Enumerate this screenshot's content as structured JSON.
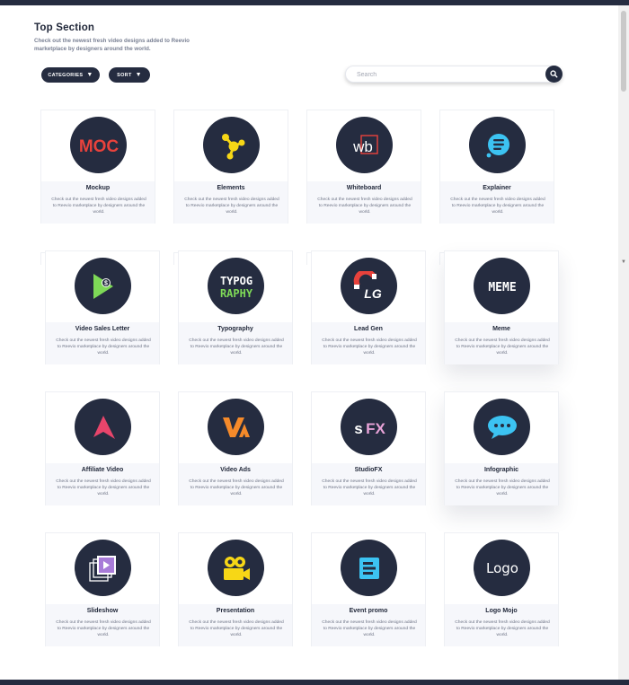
{
  "header": {
    "title": "Top Section",
    "subtitle": "Check out the newest fresh video designs added to Reevio marketplace by designers around the world."
  },
  "controls": {
    "categories_label": "CATEGORIES",
    "sort_label": "SORT",
    "search_placeholder": "Search"
  },
  "colors": {
    "navy": "#252c40",
    "accent_yellow": "#f7d716",
    "accent_red": "#e8423c",
    "accent_blue": "#3cc3f2",
    "accent_pink": "#e8456b",
    "accent_orange": "#f58a2a",
    "accent_green": "#7ed957"
  },
  "cards": [
    {
      "name": "Mockup",
      "description": "Check out the newest fresh video designs added to Reevio marketplace by designers around the world.",
      "icon": "mockup-logo-icon"
    },
    {
      "name": "Elements",
      "description": "Check out the newest fresh video designs added to Reevio marketplace by designers around the world.",
      "icon": "elements-network-icon"
    },
    {
      "name": "Whiteboard",
      "description": "Check out the newest fresh video designs added to Reevio marketplace by designers around the world.",
      "icon": "whiteboard-wb-icon"
    },
    {
      "name": "Explainer",
      "description": "Check out the newest fresh video designs added to Reevio marketplace by designers around the world.",
      "icon": "explainer-bubble-icon"
    },
    {
      "name": "Video Sales Letter",
      "description": "Check out the newest fresh video designs added to Reevio marketplace by designers around the world.",
      "icon": "play-dollar-icon"
    },
    {
      "name": "Typography",
      "description": "Check out the newest fresh video designs added to Reevio marketplace by designers around the world.",
      "icon": "typography-text-icon"
    },
    {
      "name": "Lead Gen",
      "description": "Check out the newest fresh video designs added to Reevio marketplace by designers around the world.",
      "icon": "magnet-lg-icon"
    },
    {
      "name": "Meme",
      "description": "Check out the newest fresh video designs added to Reevio marketplace by designers around the world.",
      "icon": "meme-text-icon"
    },
    {
      "name": "Affiliate Video",
      "description": "Check out the newest fresh video designs added to Reevio marketplace by designers around the world.",
      "icon": "affiliate-a-icon"
    },
    {
      "name": "Video Ads",
      "description": "Check out the newest fresh video designs added to Reevio marketplace by designers around the world.",
      "icon": "video-ads-va-icon"
    },
    {
      "name": "StudioFX",
      "description": "Check out the newest fresh video designs added to Reevio marketplace by designers around the world.",
      "icon": "sfx-text-icon"
    },
    {
      "name": "Infographic",
      "description": "Check out the newest fresh video designs added to Reevio marketplace by designers around the world.",
      "icon": "chat-bubble-icon"
    },
    {
      "name": "Slideshow",
      "description": "Check out the newest fresh video designs added to Reevio marketplace by designers around the world.",
      "icon": "slideshow-stack-icon"
    },
    {
      "name": "Presentation",
      "description": "Check out the newest fresh video designs added to Reevio marketplace by designers around the world.",
      "icon": "camera-icon"
    },
    {
      "name": "Event promo",
      "description": "Check out the newest fresh video designs added to Reevio marketplace by designers around the world.",
      "icon": "event-document-icon"
    },
    {
      "name": "Logo Mojo",
      "description": "Check out the newest fresh video designs added to Reevio marketplace by designers around the world.",
      "icon": "logo-text-icon"
    }
  ],
  "icon_text": {
    "mockup": "MOC",
    "typo_top": "TYPOG",
    "typo_bottom": "RAPHY",
    "meme": "MEME",
    "sfx_s": "s",
    "sfx_fx": "FX",
    "logo": "Logo",
    "wb": "wb",
    "lg": "LG"
  }
}
